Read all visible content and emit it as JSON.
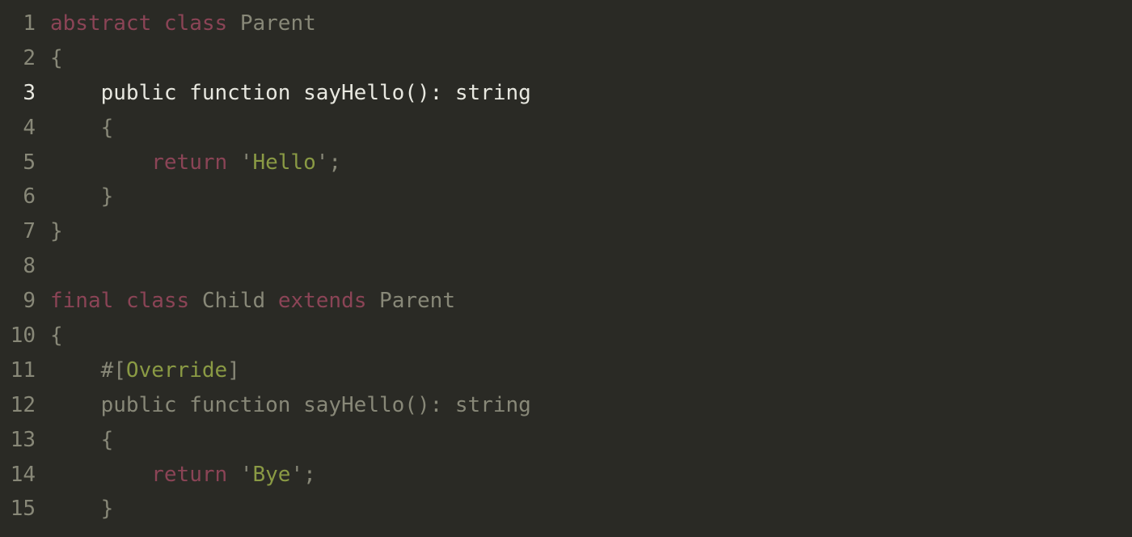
{
  "editor": {
    "active_line": 3,
    "lines": [
      {
        "num": "1",
        "tokens": [
          {
            "t": "abstract",
            "c": "token-keyword"
          },
          {
            "t": " ",
            "c": "token-default"
          },
          {
            "t": "class",
            "c": "token-keyword"
          },
          {
            "t": " ",
            "c": "token-default"
          },
          {
            "t": "Parent",
            "c": "token-class"
          }
        ]
      },
      {
        "num": "2",
        "tokens": [
          {
            "t": "{",
            "c": "token-default"
          }
        ]
      },
      {
        "num": "3",
        "active": true,
        "tokens": [
          {
            "t": "    public function sayHello(): string",
            "c": "token-bright"
          }
        ]
      },
      {
        "num": "4",
        "tokens": [
          {
            "t": "    {",
            "c": "token-default"
          }
        ]
      },
      {
        "num": "5",
        "tokens": [
          {
            "t": "        ",
            "c": "token-default"
          },
          {
            "t": "return",
            "c": "token-keyword"
          },
          {
            "t": " ",
            "c": "token-default"
          },
          {
            "t": "'",
            "c": "token-default"
          },
          {
            "t": "Hello",
            "c": "token-string"
          },
          {
            "t": "'",
            "c": "token-default"
          },
          {
            "t": ";",
            "c": "token-default"
          }
        ]
      },
      {
        "num": "6",
        "tokens": [
          {
            "t": "    }",
            "c": "token-default"
          }
        ]
      },
      {
        "num": "7",
        "tokens": [
          {
            "t": "}",
            "c": "token-default"
          }
        ]
      },
      {
        "num": "8",
        "tokens": [
          {
            "t": "",
            "c": "token-default"
          }
        ]
      },
      {
        "num": "9",
        "tokens": [
          {
            "t": "final",
            "c": "token-keyword"
          },
          {
            "t": " ",
            "c": "token-default"
          },
          {
            "t": "class",
            "c": "token-keyword"
          },
          {
            "t": " ",
            "c": "token-default"
          },
          {
            "t": "Child",
            "c": "token-class"
          },
          {
            "t": " ",
            "c": "token-default"
          },
          {
            "t": "extends",
            "c": "token-keyword"
          },
          {
            "t": " ",
            "c": "token-default"
          },
          {
            "t": "Parent",
            "c": "token-class"
          }
        ]
      },
      {
        "num": "10",
        "tokens": [
          {
            "t": "{",
            "c": "token-default"
          }
        ]
      },
      {
        "num": "11",
        "tokens": [
          {
            "t": "    #[",
            "c": "token-default"
          },
          {
            "t": "Override",
            "c": "token-attr"
          },
          {
            "t": "]",
            "c": "token-default"
          }
        ]
      },
      {
        "num": "12",
        "tokens": [
          {
            "t": "    public function sayHello(): string",
            "c": "token-default"
          }
        ]
      },
      {
        "num": "13",
        "tokens": [
          {
            "t": "    {",
            "c": "token-default"
          }
        ]
      },
      {
        "num": "14",
        "tokens": [
          {
            "t": "        ",
            "c": "token-default"
          },
          {
            "t": "return",
            "c": "token-keyword"
          },
          {
            "t": " ",
            "c": "token-default"
          },
          {
            "t": "'",
            "c": "token-default"
          },
          {
            "t": "Bye",
            "c": "token-string"
          },
          {
            "t": "'",
            "c": "token-default"
          },
          {
            "t": ";",
            "c": "token-default"
          }
        ]
      },
      {
        "num": "15",
        "tokens": [
          {
            "t": "    }",
            "c": "token-default"
          }
        ]
      }
    ]
  }
}
